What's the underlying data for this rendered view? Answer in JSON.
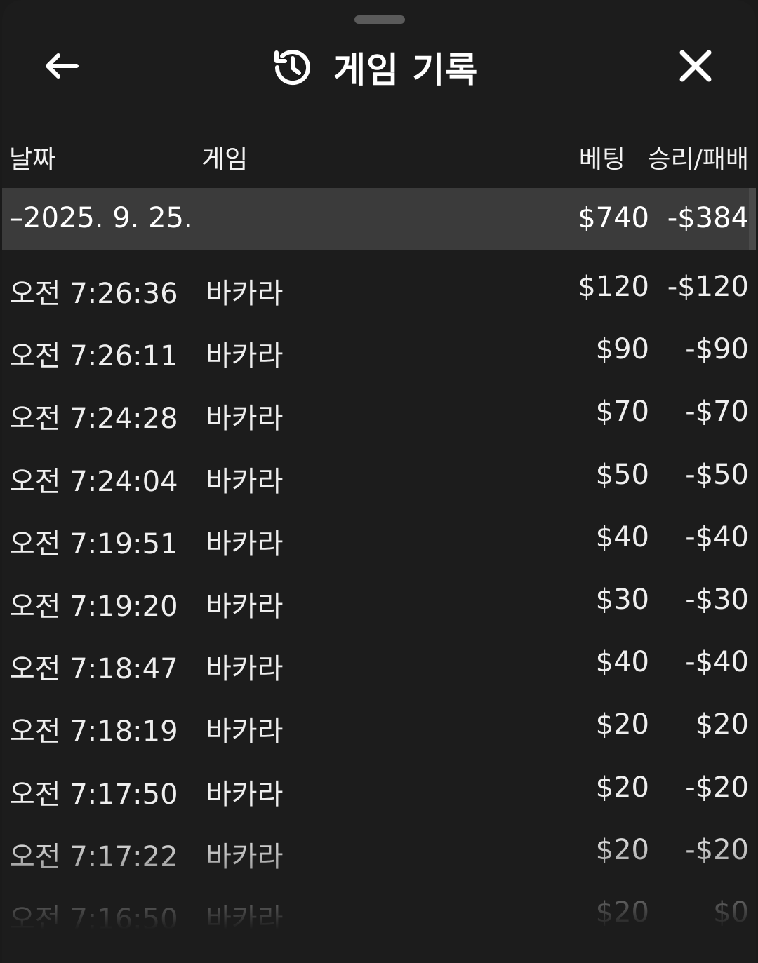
{
  "header": {
    "title": "게임 기록",
    "back_icon": "arrow-left-icon",
    "history_icon": "history-icon",
    "close_icon": "close-icon"
  },
  "columns": {
    "date": "날짜",
    "game": "게임",
    "bet": "베팅",
    "win_loss": "승리/패배"
  },
  "date_group": {
    "date": "–2025. 9. 25.",
    "bet_total": "$740",
    "win_loss_total": "-$384"
  },
  "rows": [
    {
      "time": "오전 7:26:36",
      "game": "바카라",
      "bet": "$120",
      "win_loss": "-$120"
    },
    {
      "time": "오전 7:26:11",
      "game": "바카라",
      "bet": "$90",
      "win_loss": "-$90"
    },
    {
      "time": "오전 7:24:28",
      "game": "바카라",
      "bet": "$70",
      "win_loss": "-$70"
    },
    {
      "time": "오전 7:24:04",
      "game": "바카라",
      "bet": "$50",
      "win_loss": "-$50"
    },
    {
      "time": "오전 7:19:51",
      "game": "바카라",
      "bet": "$40",
      "win_loss": "-$40"
    },
    {
      "time": "오전 7:19:20",
      "game": "바카라",
      "bet": "$30",
      "win_loss": "-$30"
    },
    {
      "time": "오전 7:18:47",
      "game": "바카라",
      "bet": "$40",
      "win_loss": "-$40"
    },
    {
      "time": "오전 7:18:19",
      "game": "바카라",
      "bet": "$20",
      "win_loss": "$20"
    },
    {
      "time": "오전 7:17:50",
      "game": "바카라",
      "bet": "$20",
      "win_loss": "-$20"
    },
    {
      "time": "오전 7:17:22",
      "game": "바카라",
      "bet": "$20",
      "win_loss": "-$20"
    },
    {
      "time": "오전 7:16:50",
      "game": "바카라",
      "bet": "$20",
      "win_loss": "$0"
    }
  ]
}
